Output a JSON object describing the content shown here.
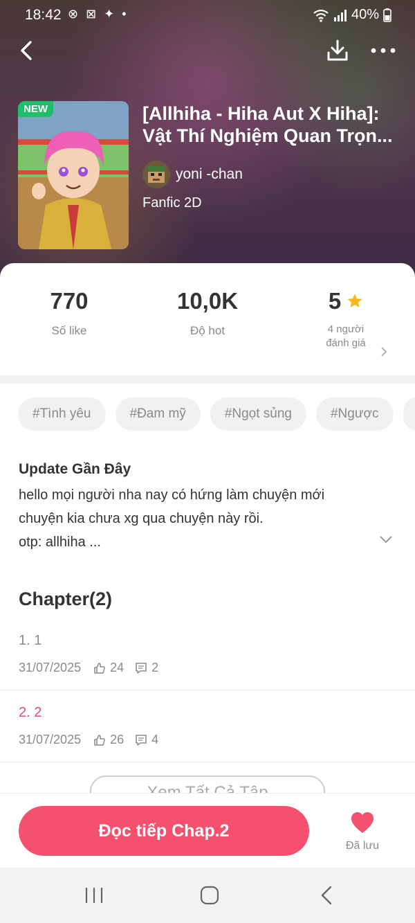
{
  "status_bar": {
    "time": "18:42",
    "notifications": "⊗ ⊠ ✦ •",
    "battery": "40%"
  },
  "book": {
    "badge": "NEW",
    "title_line1": "[Allhiha - Hiha Aut X Hiha]:",
    "title_line2": "Vật Thí Nghiệm Quan Trọn...",
    "author": "yoni -chan",
    "genre": "Fanfic 2D"
  },
  "stats": {
    "likes": {
      "value": "770",
      "label": "Số like"
    },
    "hot": {
      "value": "10,0K",
      "label": "Độ hot"
    },
    "rating": {
      "value": "5",
      "label_line1": "4 người",
      "label_line2": "đánh giá"
    }
  },
  "tags": [
    "#Tình yêu",
    "#Đam mỹ",
    "#Ngọt sủng",
    "#Ngược"
  ],
  "update": {
    "title": "Update Gần Đây",
    "line1": "hello mọi người nha nay có hứng làm chuyện mới",
    "line2": "chuyện kia chưa xg qua chuyện này rồi.",
    "line3": "otp: allhiha ..."
  },
  "chapters": {
    "heading": "Chapter(2)",
    "items": [
      {
        "title": "1. 1",
        "date": "31/07/2025",
        "likes": "24",
        "comments": "2"
      },
      {
        "title": "2. 2",
        "date": "31/07/2025",
        "likes": "26",
        "comments": "4"
      }
    ],
    "see_all": "Xem Tất Cả Tập"
  },
  "actions": {
    "read_label": "Đọc tiếp Chap.2",
    "saved_label": "Đã lưu"
  },
  "colors": {
    "accent": "#f5516f",
    "new_badge": "#1fbe6a",
    "star": "#f5b81c"
  },
  "icons": [
    "back-arrow-icon",
    "download-icon",
    "more-icon",
    "star-icon",
    "chevron-right-icon",
    "chevron-down-icon",
    "thumb-up-icon",
    "comment-icon",
    "heart-icon",
    "recent-apps-icon",
    "home-icon",
    "back-icon"
  ]
}
